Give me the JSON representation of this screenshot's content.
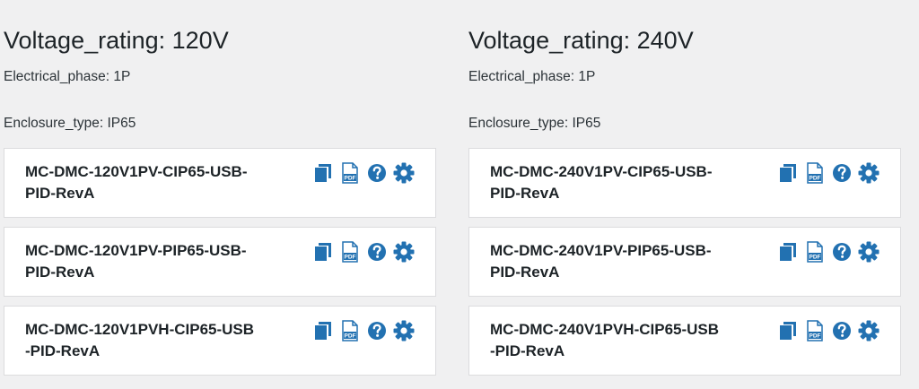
{
  "groups": [
    {
      "title": "Voltage_rating: 120V",
      "phase": "Electrical_phase: 1P",
      "enclosure": "Enclosure_type: IP65",
      "items": [
        {
          "line1": "MC-DMC-120V1PV-CIP65-USB-",
          "line2": "PID-RevA"
        },
        {
          "line1": "MC-DMC-120V1PV-PIP65-USB-",
          "line2": "PID-RevA"
        },
        {
          "line1": "MC-DMC-120V1PVH-CIP65-USB",
          "line2": "-PID-RevA"
        }
      ]
    },
    {
      "title": "Voltage_rating: 240V",
      "phase": "Electrical_phase: 1P",
      "enclosure": "Enclosure_type: IP65",
      "items": [
        {
          "line1": "MC-DMC-240V1PV-CIP65-USB-",
          "line2": "PID-RevA"
        },
        {
          "line1": "MC-DMC-240V1PV-PIP65-USB-",
          "line2": "PID-RevA"
        },
        {
          "line1": "MC-DMC-240V1PVH-CIP65-USB",
          "line2": "-PID-RevA"
        }
      ]
    }
  ],
  "icons": [
    "copy-icon",
    "pdf-icon",
    "help-icon",
    "settings-icon"
  ],
  "colors": {
    "background": "#f0f0f1",
    "card": "#ffffff",
    "card_border": "#dcdcde",
    "icon_blue": "#2271b1",
    "text": "#1d2327"
  }
}
